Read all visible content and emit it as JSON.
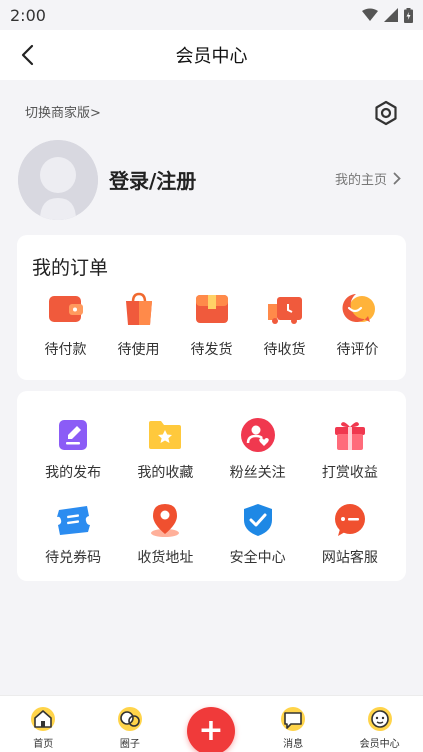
{
  "status_bar": {
    "time": "2:00"
  },
  "nav": {
    "title": "会员中心"
  },
  "profile": {
    "switch_merchant": "切换商家版>",
    "login_text": "登录/注册",
    "homepage_link": "我的主页"
  },
  "orders": {
    "title": "我的订单",
    "items": [
      {
        "label": "待付款",
        "icon": "wallet-icon"
      },
      {
        "label": "待使用",
        "icon": "shopping-bag-icon"
      },
      {
        "label": "待发货",
        "icon": "package-icon"
      },
      {
        "label": "待收货",
        "icon": "delivery-truck-icon"
      },
      {
        "label": "待评价",
        "icon": "comment-icon"
      }
    ]
  },
  "services": {
    "items": [
      {
        "label": "我的发布",
        "icon": "edit-icon"
      },
      {
        "label": "我的收藏",
        "icon": "star-folder-icon"
      },
      {
        "label": "粉丝关注",
        "icon": "fans-icon"
      },
      {
        "label": "打赏收益",
        "icon": "gift-icon"
      },
      {
        "label": "待兑券码",
        "icon": "coupon-icon"
      },
      {
        "label": "收货地址",
        "icon": "location-icon"
      },
      {
        "label": "安全中心",
        "icon": "shield-icon"
      },
      {
        "label": "网站客服",
        "icon": "customer-service-icon"
      }
    ]
  },
  "tab_bar": {
    "items": [
      {
        "label": "首页",
        "icon": "home-icon"
      },
      {
        "label": "圈子",
        "icon": "circle-icon"
      },
      {
        "label": "消息",
        "icon": "message-icon"
      },
      {
        "label": "会员中心",
        "icon": "member-icon"
      }
    ],
    "fab_label": "+"
  },
  "colors": {
    "accent": "#f03a3a",
    "background": "#f4f4f7"
  }
}
